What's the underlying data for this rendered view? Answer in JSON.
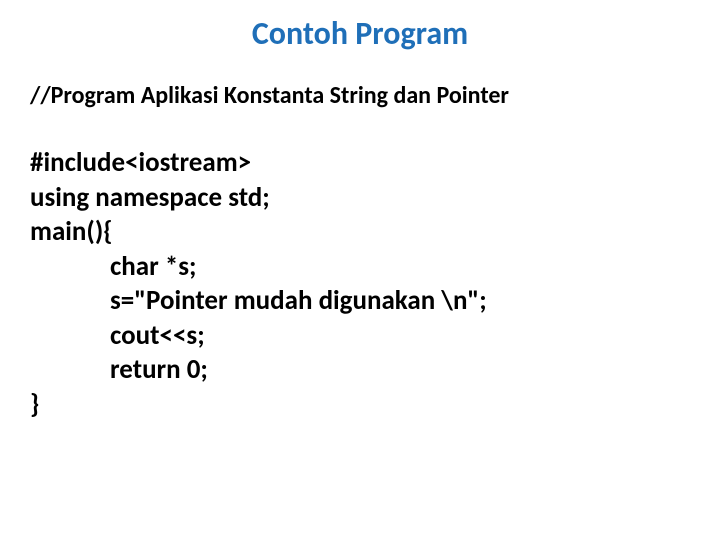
{
  "slide": {
    "title": "Contoh Program",
    "comment": "//Program Aplikasi Konstanta String dan Pointer",
    "code": {
      "line1": "#include<iostream>",
      "line2": "using namespace std;",
      "line3": "main(){",
      "line4": "char *s;",
      "line5": "s=\"Pointer mudah digunakan \\n\";",
      "line6": "cout<<s;",
      "line7": "return 0;",
      "line8": "}"
    }
  }
}
